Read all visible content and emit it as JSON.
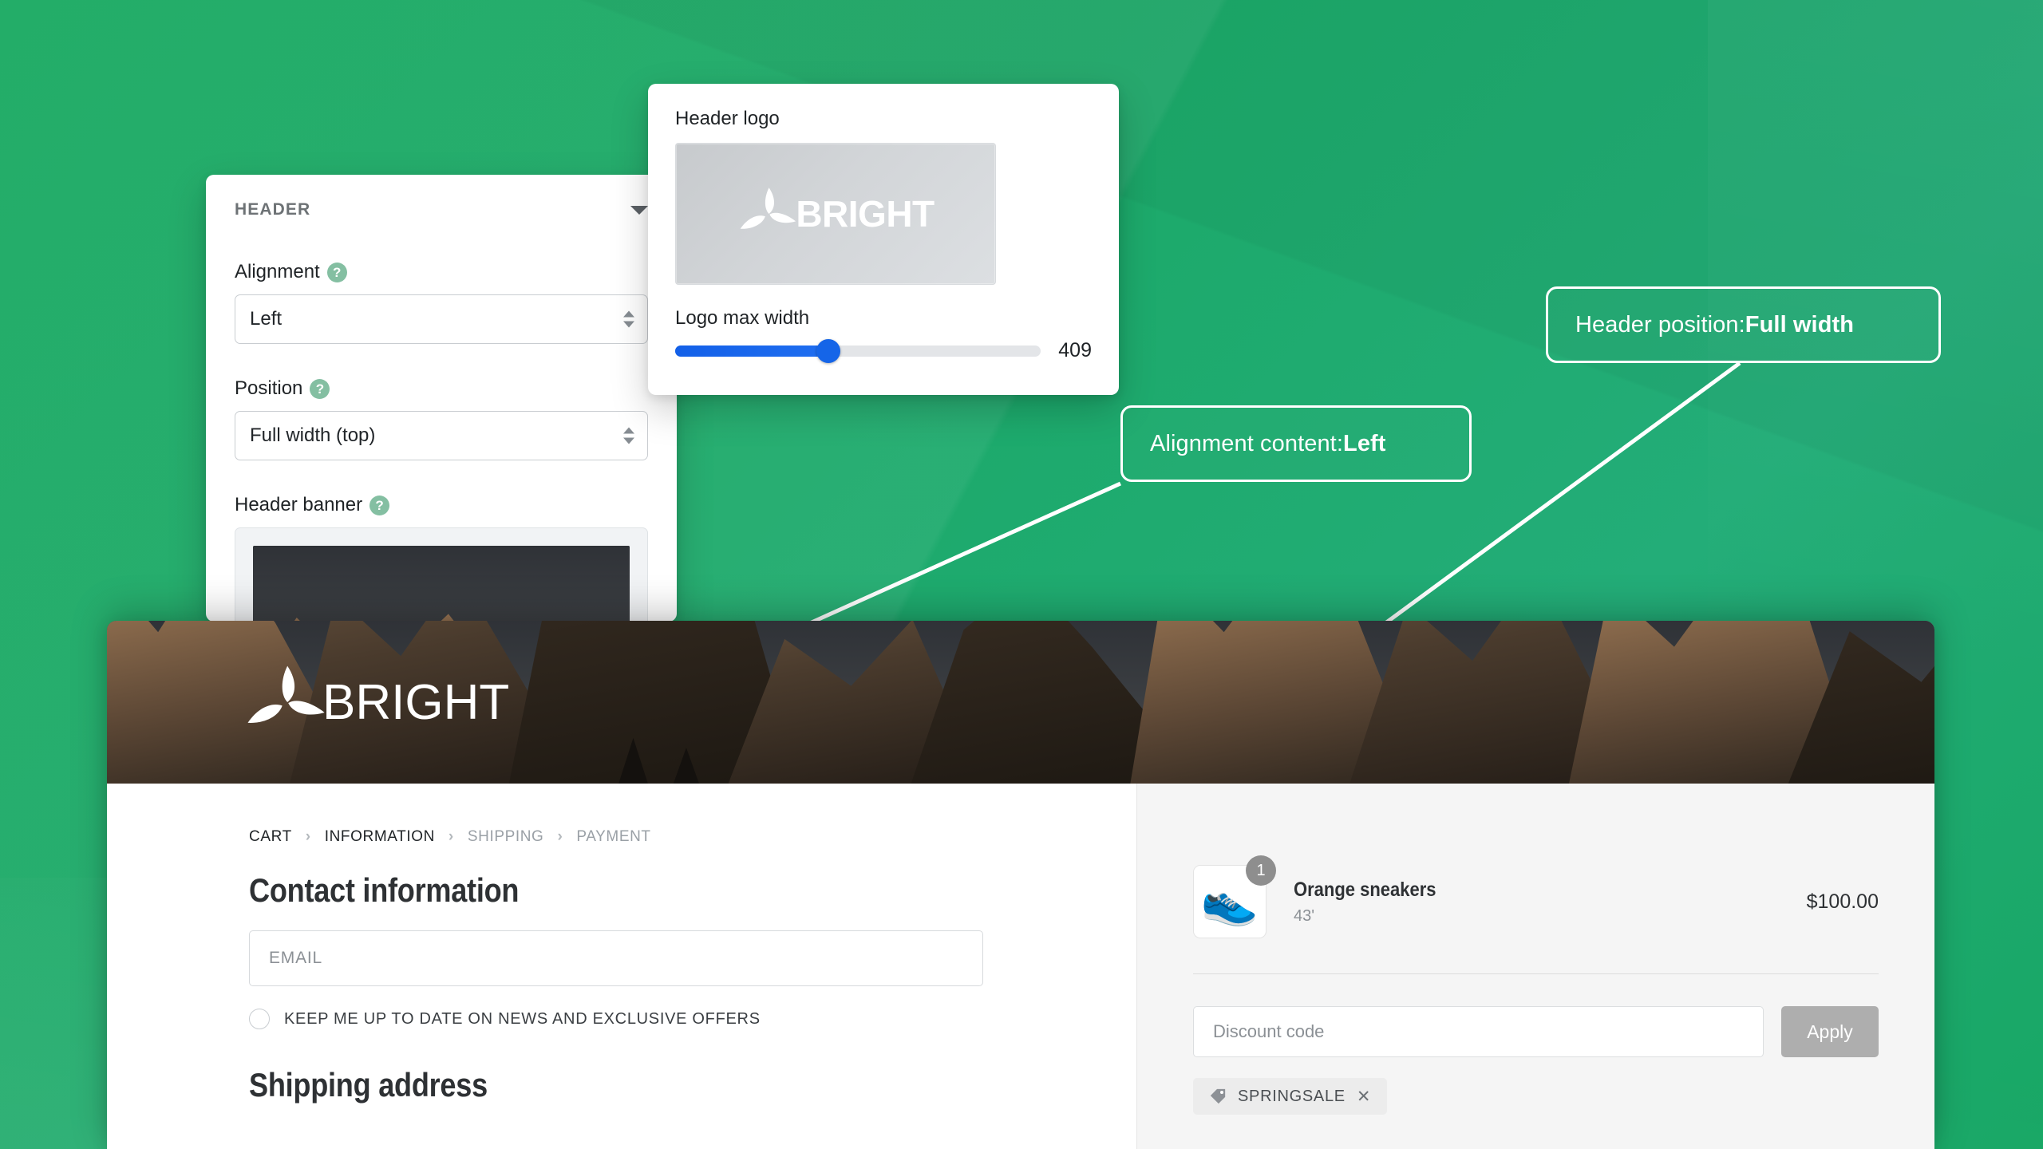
{
  "theme": {
    "background_green": "#18a765",
    "callout_border": "#ffffff",
    "slider_accent": "#1565e8",
    "help_dot": "#84bfa2"
  },
  "customizer": {
    "header_panel": {
      "title": "HEADER",
      "collapse_icon": "caret-down-icon",
      "fields": [
        {
          "label": "Alignment",
          "help": "?",
          "value": "Left"
        },
        {
          "label": "Position",
          "help": "?",
          "value": "Full width (top)"
        },
        {
          "label": "Header banner",
          "help": "?"
        }
      ]
    },
    "logo_panel": {
      "logo_label": "Header logo",
      "logo_wordmark": "BRIGHT",
      "slider_label": "Logo max width",
      "slider_value": "409",
      "slider_percent": 42
    }
  },
  "callouts": [
    {
      "prefix": "Alignment content: ",
      "value": "Left"
    },
    {
      "prefix": "Header position: ",
      "value": "Full width"
    }
  ],
  "checkout": {
    "banner_wordmark": "BRIGHT",
    "breadcrumbs": [
      {
        "label": "CART",
        "active": true
      },
      {
        "label": "INFORMATION",
        "active": true
      },
      {
        "label": "SHIPPING",
        "active": false
      },
      {
        "label": "PAYMENT",
        "active": false
      }
    ],
    "breadcrumb_separator": "›",
    "contact": {
      "heading": "Contact information",
      "email_placeholder": "EMAIL",
      "newsletter_label": "KEEP ME UP TO DATE ON NEWS AND EXCLUSIVE OFFERS"
    },
    "shipping": {
      "heading": "Shipping address"
    },
    "summary": {
      "item": {
        "name": "Orange sneakers",
        "variant": "43'",
        "price": "$100.00",
        "quantity": "1",
        "image": "orange-sneaker-icon"
      },
      "discount_placeholder": "Discount code",
      "apply_label": "Apply",
      "applied_code": "SPRINGSALE",
      "applied_code_remove": "✕",
      "tag_icon": "tag-icon"
    }
  }
}
